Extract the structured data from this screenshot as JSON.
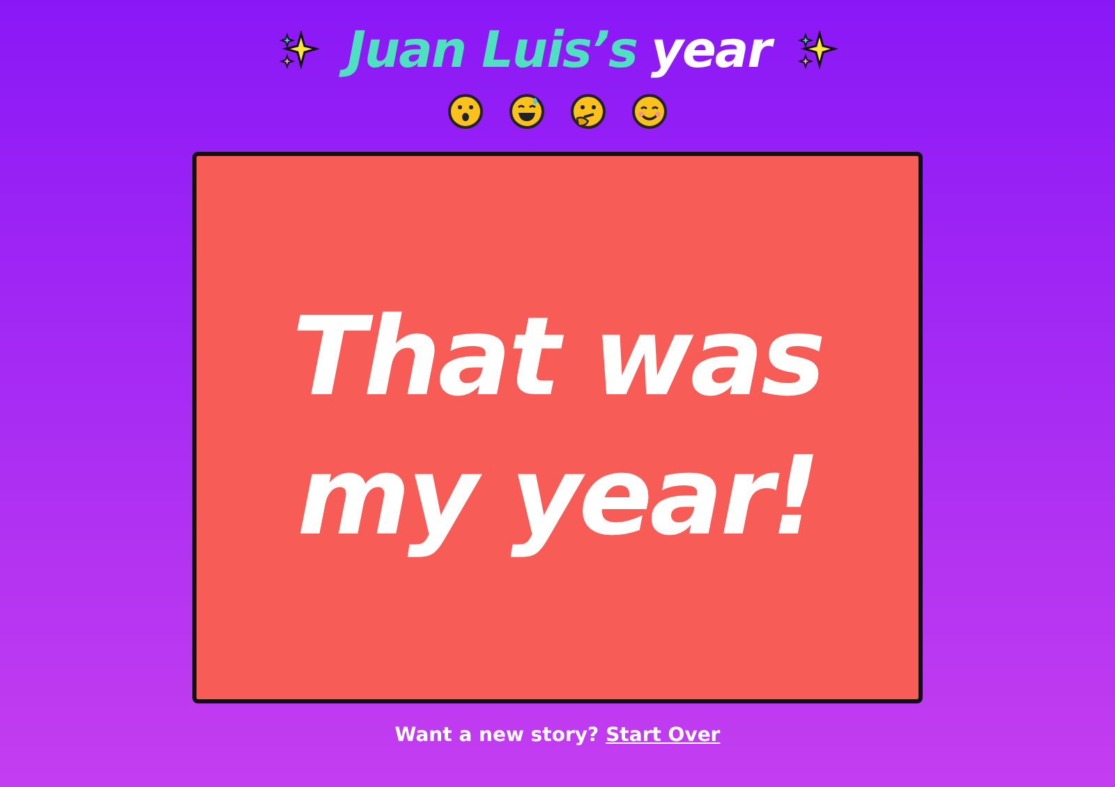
{
  "header": {
    "name": "Juan Luis’s",
    "suffix": "year"
  },
  "card": {
    "color": "#f85c57",
    "message": "That was my year!"
  },
  "footer": {
    "prompt": "Want a new story?",
    "link": "Start Over"
  }
}
